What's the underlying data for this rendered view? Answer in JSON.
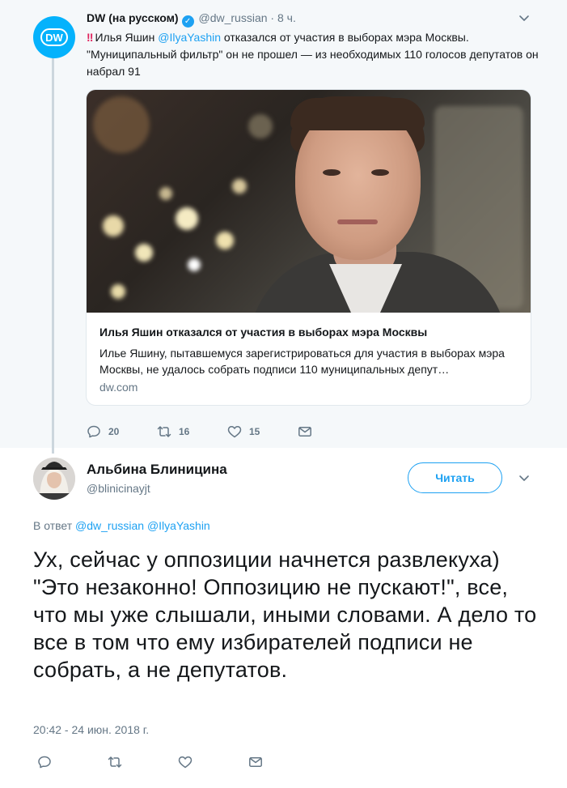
{
  "parent_tweet": {
    "author_name": "DW (на русском)",
    "avatar_text": "DW",
    "handle": "@dw_russian",
    "dot": "·",
    "time": "8 ч.",
    "text_prefix": "‼",
    "text_part1": "Илья Яшин ",
    "text_mention": "@IlyaYashin",
    "text_part2": " отказался от участия в выборах мэра Москвы. \"Муниципальный фильтр\" он не прошел — из необходимых 110 голосов депутатов он набрал 91",
    "card": {
      "title": "Илья Яшин отказался от участия в выборах мэра Москвы",
      "description": "Илье Яшину, пытавшемуся зарегистрироваться для участия в выборах мэра Москвы, не удалось собрать подписи 110 муниципальных депут…",
      "domain": "dw.com"
    },
    "actions": {
      "replies": "20",
      "retweets": "16",
      "likes": "15"
    }
  },
  "reply_tweet": {
    "author_name": "Альбина Блиницина",
    "handle": "@blinicinayjt",
    "follow_label": "Читать",
    "reply_to_prefix": "В ответ ",
    "reply_to_mention1": "@dw_russian",
    "reply_to_mention2": "@IlyaYashin",
    "text": "Ух, сейчас у оппозиции начнется развлекуха) \"Это незаконно! Оппозицию не пускают!\", все, что мы уже слышали, иными словами. А дело то все в том что ему избирателей подписи не собрать, а не депутатов.",
    "timestamp": "20:42 - 24 июн. 2018 г."
  },
  "colors": {
    "accent": "#1da1f2",
    "secondary_text": "#657786",
    "parent_background": "#f5f8fa",
    "dw_brand": "#05b2fc"
  }
}
